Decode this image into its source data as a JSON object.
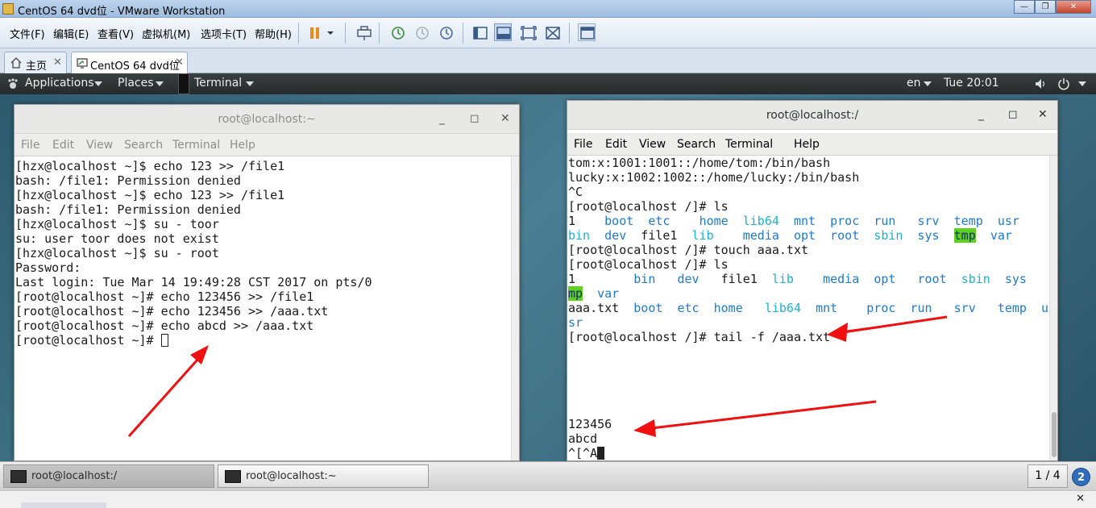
{
  "window": {
    "title": "CentOS 64 dvd位 - VMware Workstation",
    "controls": {
      "minimize": "—",
      "maximize": "❐",
      "close": "✕"
    }
  },
  "vm_menu": [
    "文件(F)",
    "编辑(E)",
    "查看(V)",
    "虚拟机(M)",
    "选项卡(T)",
    "帮助(H)"
  ],
  "vm_tabs": [
    {
      "label": "主页",
      "icon": "home-icon"
    },
    {
      "label": "CentOS 64 dvd位",
      "icon": "vm-icon"
    }
  ],
  "gnome_bar": {
    "applications": "Applications",
    "places": "Places",
    "terminal": "Terminal",
    "lang": "en",
    "clock": "Tue 20:01"
  },
  "term_left": {
    "title": "root@localhost:~",
    "menu": [
      "File",
      "Edit",
      "View",
      "Search",
      "Terminal",
      "Help"
    ],
    "lines": [
      "[hzx@localhost ~]$ echo 123 >> /file1",
      "bash: /file1: Permission denied",
      "[hzx@localhost ~]$ echo 123 >> /file1",
      "bash: /file1: Permission denied",
      "[hzx@localhost ~]$ su - toor",
      "su: user toor does not exist",
      "[hzx@localhost ~]$ su - root",
      "Password:",
      "Last login: Tue Mar 14 19:49:28 CST 2017 on pts/0",
      "[root@localhost ~]# echo 123456 >> /file1",
      "[root@localhost ~]# echo 123456 >> /aaa.txt",
      "[root@localhost ~]# echo abcd >> /aaa.txt",
      "[root@localhost ~]# "
    ]
  },
  "term_right": {
    "title": "root@localhost:/",
    "menu": [
      "File",
      "Edit",
      "View",
      "Search",
      "Terminal",
      "Help"
    ],
    "lines": [
      [
        {
          "t": "tom:x:1001:1001::/home/tom:/bin/bash"
        }
      ],
      [
        {
          "t": "lucky:x:1002:1002::/home/lucky:/bin/bash"
        }
      ],
      [
        {
          "t": "^C"
        }
      ],
      [
        {
          "t": "[root@localhost /]# ls"
        }
      ],
      [
        {
          "t": "1    "
        },
        {
          "t": "boot",
          "c": "blue"
        },
        {
          "t": "  "
        },
        {
          "t": "etc",
          "c": "blue"
        },
        {
          "t": "    "
        },
        {
          "t": "home",
          "c": "blue"
        },
        {
          "t": "  "
        },
        {
          "t": "lib64",
          "c": "cyan"
        },
        {
          "t": "  "
        },
        {
          "t": "mnt",
          "c": "blue"
        },
        {
          "t": "  "
        },
        {
          "t": "proc",
          "c": "blue"
        },
        {
          "t": "  "
        },
        {
          "t": "run",
          "c": "blue"
        },
        {
          "t": "   "
        },
        {
          "t": "srv",
          "c": "blue"
        },
        {
          "t": "  "
        },
        {
          "t": "temp",
          "c": "blue"
        },
        {
          "t": "  "
        },
        {
          "t": "usr",
          "c": "blue"
        }
      ],
      [
        {
          "t": "bin",
          "c": "cyan"
        },
        {
          "t": "  "
        },
        {
          "t": "dev",
          "c": "blue"
        },
        {
          "t": "  file1  "
        },
        {
          "t": "lib",
          "c": "cyan"
        },
        {
          "t": "    "
        },
        {
          "t": "media",
          "c": "blue"
        },
        {
          "t": "  "
        },
        {
          "t": "opt",
          "c": "blue"
        },
        {
          "t": "  "
        },
        {
          "t": "root",
          "c": "blue"
        },
        {
          "t": "  "
        },
        {
          "t": "sbin",
          "c": "cyan"
        },
        {
          "t": "  "
        },
        {
          "t": "sys",
          "c": "blue"
        },
        {
          "t": "  "
        },
        {
          "t": "tmp",
          "c": "hl"
        },
        {
          "t": "  "
        },
        {
          "t": "var",
          "c": "blue"
        }
      ],
      [
        {
          "t": "[root@localhost /]# touch aaa.txt"
        }
      ],
      [
        {
          "t": "[root@localhost /]# ls"
        }
      ],
      [
        {
          "t": "1        "
        },
        {
          "t": "bin",
          "c": "blue"
        },
        {
          "t": "   "
        },
        {
          "t": "dev",
          "c": "blue"
        },
        {
          "t": "   file1  "
        },
        {
          "t": "lib",
          "c": "cyan"
        },
        {
          "t": "    "
        },
        {
          "t": "media",
          "c": "blue"
        },
        {
          "t": "  "
        },
        {
          "t": "opt",
          "c": "blue"
        },
        {
          "t": "   "
        },
        {
          "t": "root",
          "c": "blue"
        },
        {
          "t": "  "
        },
        {
          "t": "sbin",
          "c": "cyan"
        },
        {
          "t": "  "
        },
        {
          "t": "sys",
          "c": "blue"
        },
        {
          "t": "   "
        },
        {
          "t": "t",
          "c": "hl"
        }
      ],
      [
        {
          "t": "mp",
          "c": "hl"
        },
        {
          "t": "  "
        },
        {
          "t": "var",
          "c": "blue"
        }
      ],
      [
        {
          "t": "aaa.txt  "
        },
        {
          "t": "boot",
          "c": "blue"
        },
        {
          "t": "  "
        },
        {
          "t": "etc",
          "c": "blue"
        },
        {
          "t": "  "
        },
        {
          "t": "home",
          "c": "blue"
        },
        {
          "t": "   "
        },
        {
          "t": "lib64",
          "c": "cyan"
        },
        {
          "t": "  "
        },
        {
          "t": "mnt",
          "c": "blue"
        },
        {
          "t": "    "
        },
        {
          "t": "proc",
          "c": "blue"
        },
        {
          "t": "  "
        },
        {
          "t": "run",
          "c": "blue"
        },
        {
          "t": "   "
        },
        {
          "t": "srv",
          "c": "blue"
        },
        {
          "t": "   "
        },
        {
          "t": "temp",
          "c": "blue"
        },
        {
          "t": "  "
        },
        {
          "t": "u",
          "c": "blue"
        }
      ],
      [
        {
          "t": "sr",
          "c": "blue"
        }
      ],
      [
        {
          "t": "[root@localhost /]# tail -f /aaa.txt"
        }
      ],
      [
        {
          "t": ""
        }
      ],
      [
        {
          "t": ""
        }
      ],
      [
        {
          "t": ""
        }
      ],
      [
        {
          "t": ""
        }
      ],
      [
        {
          "t": ""
        }
      ],
      [
        {
          "t": "123456"
        }
      ],
      [
        {
          "t": "abcd"
        }
      ],
      [
        {
          "t": "^[^A"
        }
      ]
    ]
  },
  "taskbar": {
    "items": [
      {
        "label": "root@localhost:/"
      },
      {
        "label": "root@localhost:~"
      }
    ],
    "workspace": "1 / 4",
    "badge": "2"
  },
  "statusbar": {
    "close": "✕"
  },
  "colors": {
    "blue": "#1c7bd1",
    "cyan": "#1ab3d0",
    "highlight": "#5cd21f",
    "arrow": "#f01010"
  }
}
